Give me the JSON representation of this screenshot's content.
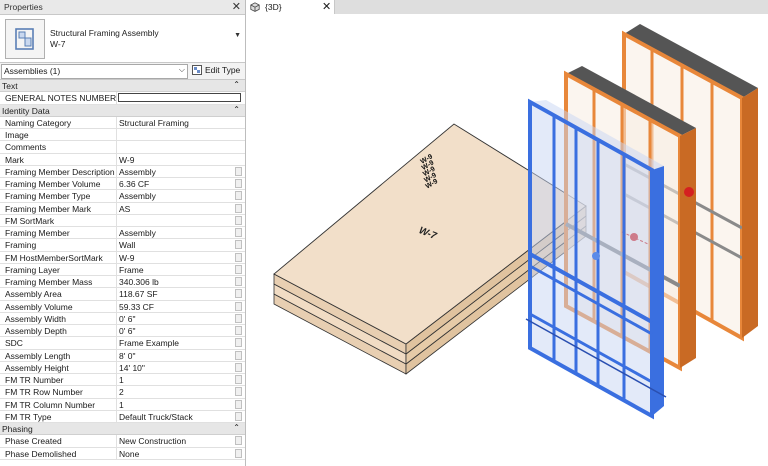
{
  "properties": {
    "title": "Properties",
    "close_label": "✕",
    "type_name": "Structural Framing Assembly",
    "type_sub": "W-7",
    "filter_label": "Assemblies (1)",
    "edit_type_label": "Edit Type",
    "categories": [
      {
        "name": "Text",
        "rows": [
          {
            "key": "GENERAL NOTES NUMBER",
            "value": "",
            "editing": true
          }
        ]
      },
      {
        "name": "Identity Data",
        "rows": [
          {
            "key": "Naming Category",
            "value": "Structural Framing"
          },
          {
            "key": "Image",
            "value": ""
          },
          {
            "key": "Comments",
            "value": ""
          },
          {
            "key": "Mark",
            "value": "W-9"
          },
          {
            "key": "Framing Member Description",
            "value": "Assembly"
          },
          {
            "key": "Framing Member Volume",
            "value": "6.36 CF"
          },
          {
            "key": "Framing Member Type",
            "value": "Assembly"
          },
          {
            "key": "Framing Member Mark",
            "value": "AS"
          },
          {
            "key": "FM SortMark",
            "value": ""
          },
          {
            "key": "Framing Member",
            "value": "Assembly"
          },
          {
            "key": "Framing",
            "value": "Wall"
          },
          {
            "key": "FM HostMemberSortMark",
            "value": "W-9"
          },
          {
            "key": "Framing Layer",
            "value": "Frame"
          },
          {
            "key": "Framing Member Mass",
            "value": "340.306 lb"
          },
          {
            "key": "Assembly Area",
            "value": "118.67 SF"
          },
          {
            "key": "Assembly Volume",
            "value": "59.33 CF"
          },
          {
            "key": "Assembly Width",
            "value": "0'  6\""
          },
          {
            "key": "Assembly Depth",
            "value": "0'  6\""
          },
          {
            "key": "SDC",
            "value": "Frame Example"
          },
          {
            "key": "Assembly Length",
            "value": "8'  0\""
          },
          {
            "key": "Assembly Height",
            "value": "14'  10\""
          },
          {
            "key": "FM TR Number",
            "value": "1"
          },
          {
            "key": "FM TR Row Number",
            "value": "2"
          },
          {
            "key": "FM TR Column Number",
            "value": "1"
          },
          {
            "key": "FM TR Type",
            "value": "Default Truck/Stack"
          }
        ]
      },
      {
        "name": "Phasing",
        "rows": [
          {
            "key": "Phase Created",
            "value": "New Construction"
          },
          {
            "key": "Phase Demolished",
            "value": "None"
          }
        ]
      }
    ],
    "collapse_glyph": "⌃"
  },
  "view_tab": {
    "label": "{3D}",
    "close_label": "✕"
  },
  "scene": {
    "stack_label": "W-7",
    "tag_text": "W-9",
    "colors": {
      "panel": "#f2dfc9",
      "wood": "#e8873a",
      "blue": "#3a6fe0",
      "steel": "#8a8a8a"
    }
  }
}
